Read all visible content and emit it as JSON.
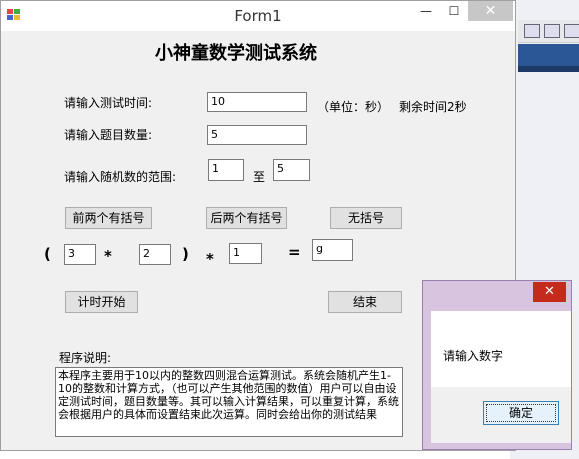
{
  "window": {
    "title": "Form1",
    "minimize_glyph": "—",
    "maximize_glyph": "☐",
    "close_glyph": "✕"
  },
  "form": {
    "heading": "小神童数学测试系统",
    "time_label": "请输入测试时间:",
    "time_value": "10",
    "unit_label": "（单位：秒）",
    "remaining_label": "剩余时间2秒",
    "count_label": "请输入题目数量:",
    "count_value": "5",
    "range_label": "请输入随机数的范围:",
    "range_from": "1",
    "range_to_label": "至",
    "range_to": "5",
    "btn_first_two": "前两个有括号",
    "btn_last_two": "后两个有括号",
    "btn_no_brackets": "无括号",
    "expr": {
      "open_paren": "(",
      "operand1": "3",
      "op1": "*",
      "operand2": "2",
      "close_paren": ")",
      "op2": "*",
      "operand3": "1",
      "equals": "=",
      "answer": "g"
    },
    "btn_start": "计时开始",
    "btn_end": "结束",
    "desc_label": "程序说明:",
    "desc_text": "本程序主要用于10以内的整数四则混合运算测试。系统会随机产生1-10的整数和计算方式，（也可以产生其他范围的数值）用户可以自由设定测试时间，题目数量等。其可以输入计算结果，可以重复计算，系统会根据用户的具体而设置结束此次运算。同时会给出你的测试结果"
  },
  "dialog": {
    "close_glyph": "✕",
    "message": "请输入数字",
    "ok_label": "确定"
  },
  "colors": {
    "dialog_frame": "#d9c4e0",
    "dialog_close": "#c42b1c",
    "ide_blue": "#2b5797"
  }
}
